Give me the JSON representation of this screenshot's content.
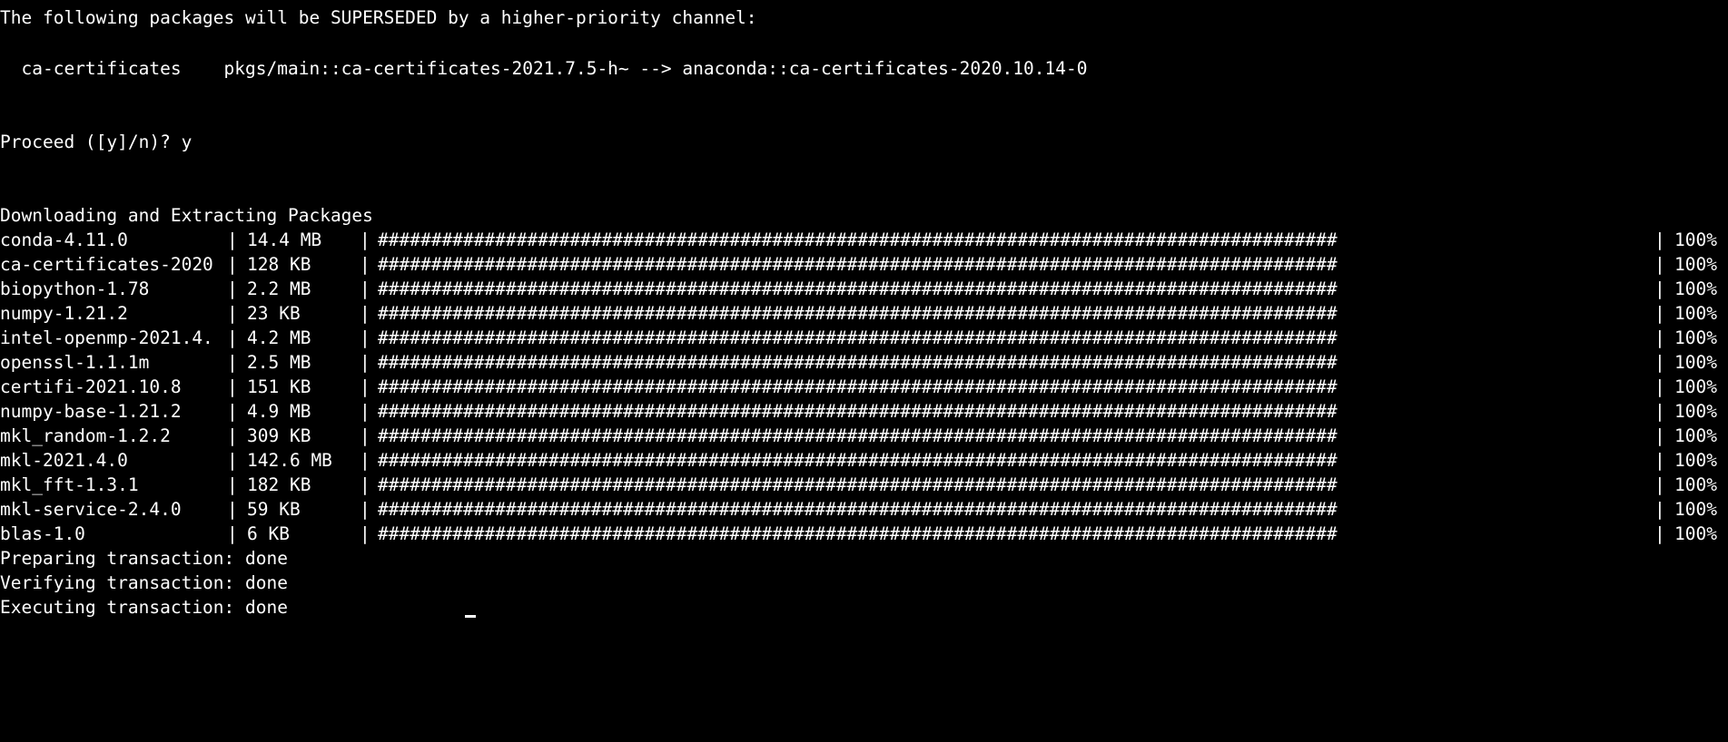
{
  "terminal": {
    "superseded_header": "The following packages will be SUPERSEDED by a higher-priority channel:",
    "superseded_pkg": "  ca-certificates    pkgs/main::ca-certificates-2021.7.5-h~ --> anaconda::ca-certificates-2020.10.14-0",
    "prompt": "Proceed ([y]/n)? y",
    "download_header": "Downloading and Extracting Packages",
    "separator": "|",
    "bar": "##########################################################################################",
    "packages": [
      {
        "name": "conda-4.11.0",
        "size": "14.4 MB",
        "percent": "100%"
      },
      {
        "name": "ca-certificates-2020",
        "size": "128 KB",
        "percent": "100%"
      },
      {
        "name": "biopython-1.78",
        "size": "2.2 MB",
        "percent": "100%"
      },
      {
        "name": "numpy-1.21.2",
        "size": "23 KB",
        "percent": "100%"
      },
      {
        "name": "intel-openmp-2021.4.",
        "size": "4.2 MB",
        "percent": "100%"
      },
      {
        "name": "openssl-1.1.1m",
        "size": "2.5 MB",
        "percent": "100%"
      },
      {
        "name": "certifi-2021.10.8",
        "size": "151 KB",
        "percent": "100%"
      },
      {
        "name": "numpy-base-1.21.2",
        "size": "4.9 MB",
        "percent": "100%"
      },
      {
        "name": "mkl_random-1.2.2",
        "size": "309 KB",
        "percent": "100%"
      },
      {
        "name": "mkl-2021.4.0",
        "size": "142.6 MB",
        "percent": "100%"
      },
      {
        "name": "mkl_fft-1.3.1",
        "size": "182 KB",
        "percent": "100%"
      },
      {
        "name": "mkl-service-2.4.0",
        "size": "59 KB",
        "percent": "100%"
      },
      {
        "name": "blas-1.0",
        "size": "6 KB",
        "percent": "100%"
      }
    ],
    "preparing": "Preparing transaction: done",
    "verifying": "Verifying transaction: done",
    "executing": "Executing transaction: done"
  }
}
